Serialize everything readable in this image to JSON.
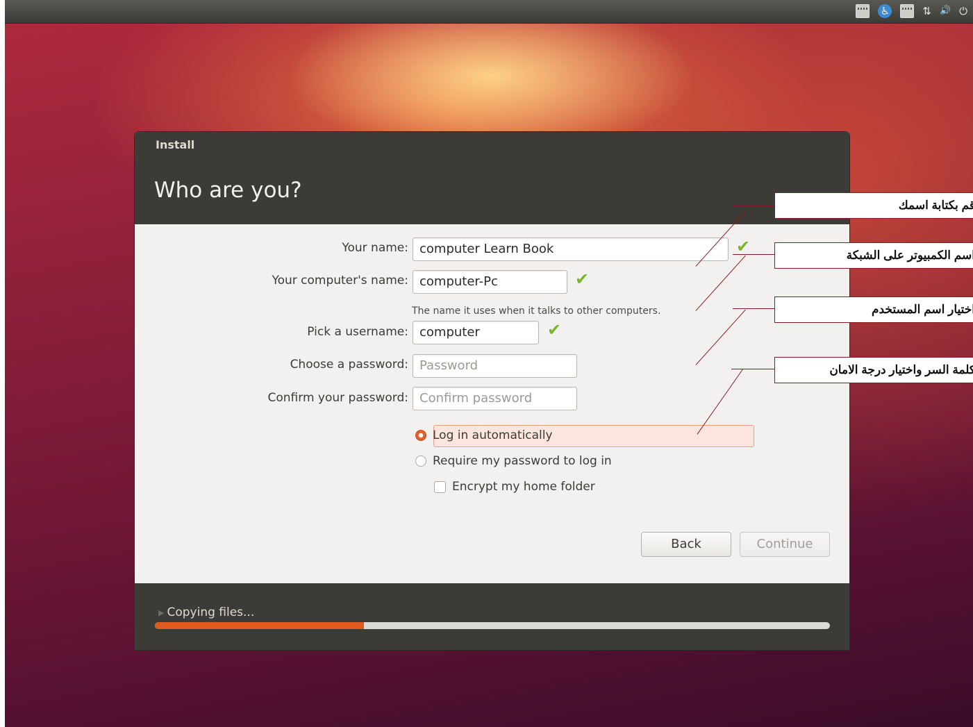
{
  "tray": {
    "icons": [
      "keyboard-icon",
      "accessibility-icon",
      "keyboard-icon",
      "network-icon",
      "volume-icon",
      "power-icon"
    ],
    "a11y_glyph": "♿",
    "network_glyph": "⇅",
    "volume_glyph": "🔊",
    "power_glyph": "⏻"
  },
  "window": {
    "title": "Install",
    "page_title": "Who are you?"
  },
  "form": {
    "name_label": "Your name:",
    "name_value": "computer Learn Book",
    "computer_label": "Your computer's name:",
    "computer_value": "computer-Pc",
    "computer_hint": "The name it uses when it talks to other computers.",
    "username_label": "Pick a username:",
    "username_value": "computer",
    "password_label": "Choose a password:",
    "password_placeholder": "Password",
    "confirm_label": "Confirm your password:",
    "confirm_placeholder": "Confirm password",
    "check_glyph": "✔"
  },
  "options": {
    "login_auto": "Log in automatically",
    "login_auto_selected": true,
    "login_password": "Require my password to log in",
    "encrypt": "Encrypt my home folder",
    "encrypt_checked": false
  },
  "buttons": {
    "back": "Back",
    "continue": "Continue"
  },
  "footer": {
    "status": "Copying files...",
    "progress": 0.31,
    "progress_color": "#e05a1e"
  },
  "callouts": [
    "قم بكتابة اسمك",
    "اسم الكمبيوتر على الشبكة",
    "اختيار اسم المستخدم",
    "كلمة السر واختيار درجة الامان"
  ],
  "colors": {
    "accent": "#e05a1e",
    "check": "#7ab52a",
    "callout_border": "#8a1a22"
  }
}
